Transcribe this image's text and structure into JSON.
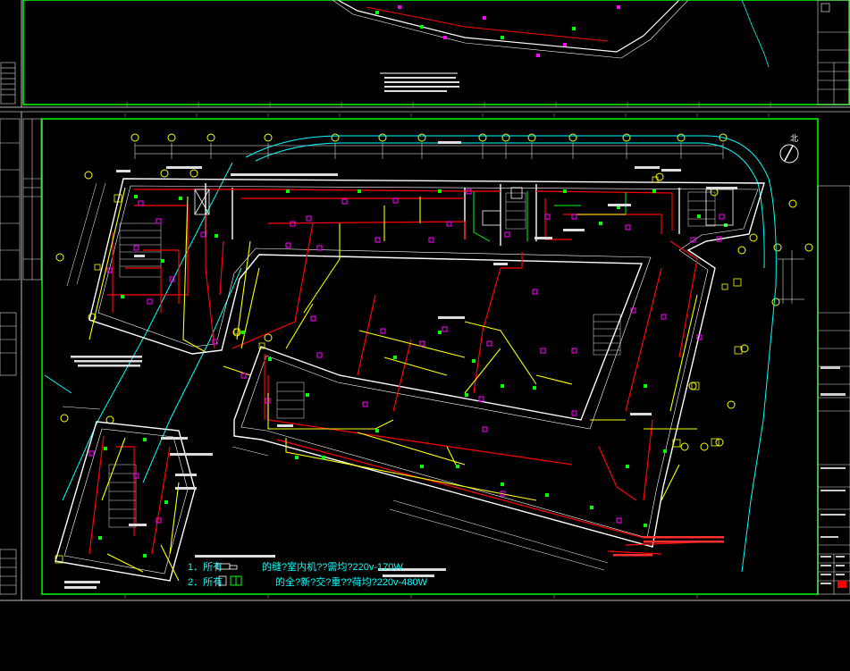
{
  "drawing": {
    "north_label": "北",
    "notes": {
      "line1_prefix": "1．所有",
      "line1_text": "的缝?室内机??需均?220v-170W",
      "line2_prefix": "2．所有",
      "line2_text": "的全?新?交?重??荷均?220v-480W"
    },
    "colors": {
      "frame": "#00ff00",
      "wall": "#ffffff",
      "power": "#ff0000",
      "light": "#ffff00",
      "device": "#ff00ff",
      "outline": "#00ffff",
      "note": "#00ffff",
      "background": "#000000"
    }
  }
}
